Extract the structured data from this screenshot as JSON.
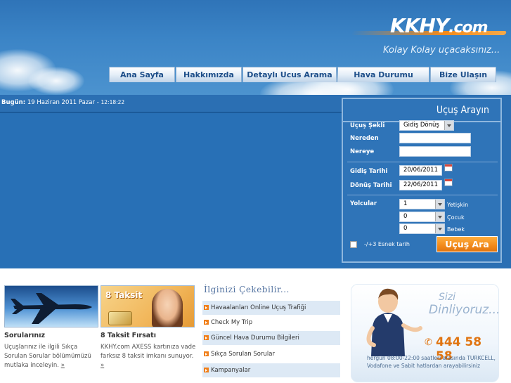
{
  "brand": {
    "logo": "KKHY",
    "logo_domain": ".com",
    "slogan": "Kolay Kolay uçacaksınız..."
  },
  "nav": {
    "items": [
      {
        "label": "Ana Sayfa"
      },
      {
        "label": "Hakkımızda"
      },
      {
        "label": "Detaylı Ucus Arama"
      },
      {
        "label": "Hava Durumu"
      },
      {
        "label": "Bize Ulaşın"
      }
    ]
  },
  "date_line": {
    "label": "Bugün:",
    "date": "19 Haziran 2011 Pazar",
    "separator": "-",
    "time": "12:18:22"
  },
  "search": {
    "title": "Uçuş Arayın",
    "trip_type_label": "Uçuş Şekli",
    "trip_type_value": "Gidiş Dönüş",
    "from_label": "Nereden",
    "from_value": "",
    "to_label": "Nereye",
    "to_value": "",
    "depart_label": "Gidiş Tarihi",
    "depart_value": "20/06/2011",
    "return_label": "Dönüş Tarihi",
    "return_value": "22/06/2011",
    "passengers_label": "Yolcular",
    "adults_value": "1",
    "adults_label": "Yetişkin",
    "children_value": "0",
    "children_label": "Çocuk",
    "infants_value": "0",
    "infants_label": "Bebek",
    "flexible_label": "-/+3 Esnek tarih",
    "submit_label": "Uçuş Ara"
  },
  "promos": [
    {
      "title": "Sorularınız",
      "text": "Uçuşlarınız ile ilgili Sıkça Sorulan Sorular bölümümüzü mutlaka inceleyin.",
      "more": "»"
    },
    {
      "title": "8 Taksit Fırsatı",
      "badge": "8 Taksit",
      "text": "KKHY.com AXESS kartınıza vade farksız 8 taksit imkanı sunuyor.",
      "more": "»"
    }
  ],
  "interest": {
    "title": "İlginizi Çekebilir...",
    "items": [
      {
        "label": "Havaalanları Online Uçuş Trafiği"
      },
      {
        "label": "Check My Trip"
      },
      {
        "label": "Güncel Hava Durumu Bilgileri"
      },
      {
        "label": "Sıkça Sorulan Sorular"
      },
      {
        "label": "Kampanyalar"
      }
    ]
  },
  "callcenter": {
    "line1": "Sizi",
    "line2": "Dinliyoruz...",
    "phone": "444 58 58",
    "info": "hergün 08:00-22:00 saatleri arasında TURKCELL, Vodafone ve Sabit hatlardan arayabilirsiniz"
  },
  "colors": {
    "header_blue": "#3b84c6",
    "hero_blue": "#2b6fb3",
    "accent_orange": "#f28a1b",
    "nav_text": "#1d4e89"
  }
}
